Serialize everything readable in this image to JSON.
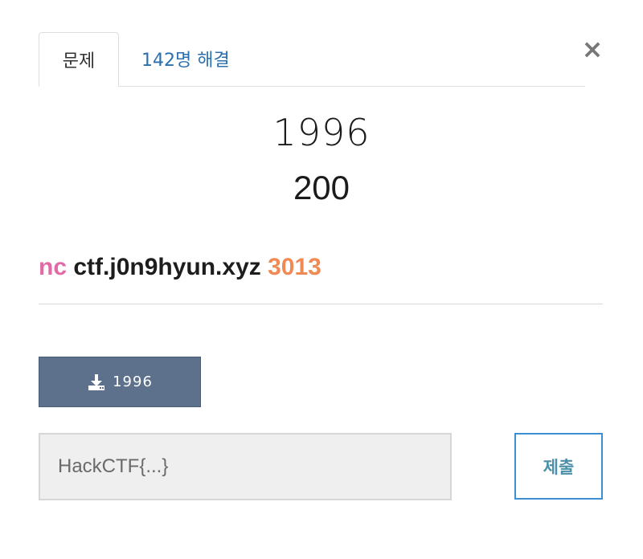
{
  "tabs": [
    {
      "label": "문제",
      "active": true
    },
    {
      "label": "142명 해결",
      "active": false
    }
  ],
  "close_label": "×",
  "challenge": {
    "name": "1996",
    "value": "200"
  },
  "description": {
    "command": "nc",
    "host": "ctf.j0n9hyun.xyz",
    "port": "3013"
  },
  "download": {
    "icon": "download-icon",
    "label": "1996"
  },
  "flag": {
    "placeholder": "HackCTF{...}",
    "value": ""
  },
  "submit_label": "제출",
  "colors": {
    "nc": "#e36aa6",
    "port": "#f08a54",
    "download_bg": "#5d718c",
    "submit_border": "#3d8fd4",
    "tab_link": "#2c6fad"
  }
}
